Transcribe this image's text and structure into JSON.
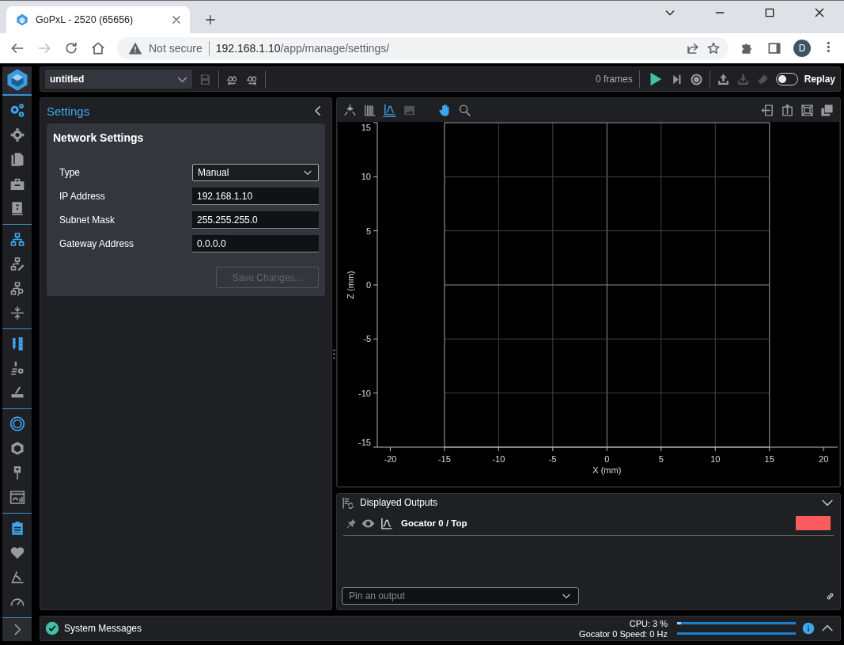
{
  "browser": {
    "tab": {
      "title": "GoPxL - 2520 (65656)"
    },
    "forward_disabled": true,
    "address": {
      "security": "Not secure",
      "host": "192.168.1.10",
      "path": "/app/manage/settings/"
    },
    "profile": "D"
  },
  "rail": {
    "groups": [
      {
        "items": [
          {
            "highlighted": true
          },
          {
            "highlighted": false
          },
          {
            "highlighted": false
          },
          {
            "highlighted": false
          },
          {
            "highlighted": false
          }
        ]
      },
      {
        "items": [
          {
            "highlighted": true
          },
          {
            "highlighted": false
          },
          {
            "highlighted": false
          },
          {
            "highlighted": false
          }
        ]
      },
      {
        "items": [
          {
            "highlighted": true
          },
          {
            "highlighted": false
          },
          {
            "highlighted": false
          }
        ]
      },
      {
        "items": [
          {
            "highlighted": true
          },
          {
            "highlighted": false
          },
          {
            "highlighted": false
          },
          {
            "highlighted": false
          }
        ]
      },
      {
        "items": [
          {
            "highlighted": true
          },
          {
            "highlighted": false
          },
          {
            "highlighted": false
          },
          {
            "highlighted": false
          }
        ]
      }
    ]
  },
  "toolbar": {
    "project": "untitled",
    "save_disabled": true,
    "frames": "0 frames",
    "actions": [
      {
        "disabled": false
      },
      {
        "disabled": true
      },
      {
        "disabled": true
      }
    ],
    "replay": {
      "label": "Replay",
      "on": false
    }
  },
  "settings": {
    "title": "Settings",
    "card": {
      "title": "Network Settings",
      "fields": [
        {
          "kind": "select",
          "label": "Type",
          "value": "Manual"
        },
        {
          "kind": "text",
          "label": "IP Address",
          "value": "192.168.1.10"
        },
        {
          "kind": "text",
          "label": "Subnet Mask",
          "value": "255.255.255.0"
        },
        {
          "kind": "text",
          "label": "Gateway Address",
          "value": "0.0.0.0"
        }
      ],
      "save": {
        "label": "Save Changes...",
        "disabled": true
      }
    }
  },
  "viewer": {
    "view_modes": [
      {
        "selected": false,
        "disabled": false
      },
      {
        "selected": false,
        "disabled": false
      },
      {
        "selected": true,
        "disabled": false
      },
      {
        "selected": false,
        "disabled": true
      }
    ],
    "tools": [
      {
        "selected": true
      },
      {
        "selected": false
      }
    ],
    "chart_data": {
      "type": "line",
      "grid": true,
      "xlabel": "X (mm)",
      "ylabel": "Z (mm)",
      "xlim": [
        -21.2,
        21.3
      ],
      "ylim": [
        -15,
        15
      ],
      "xticks": [
        -20,
        -15,
        -10,
        -5,
        0,
        5,
        10,
        15,
        20
      ],
      "yticks": [
        -15,
        -10,
        -5,
        0,
        5,
        10,
        15
      ]
    }
  },
  "outputs": {
    "title": "Displayed Outputs",
    "items": [
      {
        "name": "Gocator 0 / Top",
        "color": "#fd5c5f"
      }
    ],
    "pin": {
      "placeholder": "Pin an output"
    }
  },
  "status": {
    "messages": "System Messages",
    "cpu": {
      "label": "CPU: 3 %",
      "level": 0.03
    },
    "speed": {
      "label": "Gocator 0 Speed: 0 Hz",
      "level": 0
    }
  }
}
